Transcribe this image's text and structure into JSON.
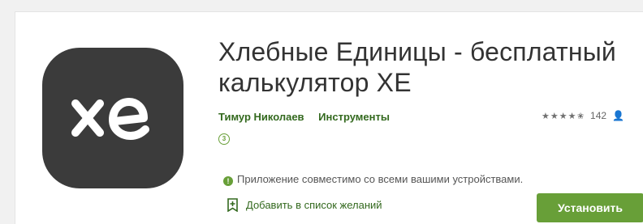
{
  "app": {
    "title": "Хлебные Единицы - бесплатный калькулятор ХЕ",
    "developer": "Тимур Николаев",
    "category": "Инструменты",
    "icon": "xe-logo-icon",
    "icon_text": "xe",
    "age_rating": "3",
    "rating_stars": 4.5,
    "stars_display": "★★★★✬",
    "rating_count": "142",
    "compatibility": "Приложение совместимо со всеми вашими устройствами.",
    "wishlist_label": "Добавить в список желаний",
    "install_label": "Установить"
  },
  "colors": {
    "accent": "#689f38",
    "link": "#33691e",
    "icon_bg": "#3b3b3b"
  }
}
